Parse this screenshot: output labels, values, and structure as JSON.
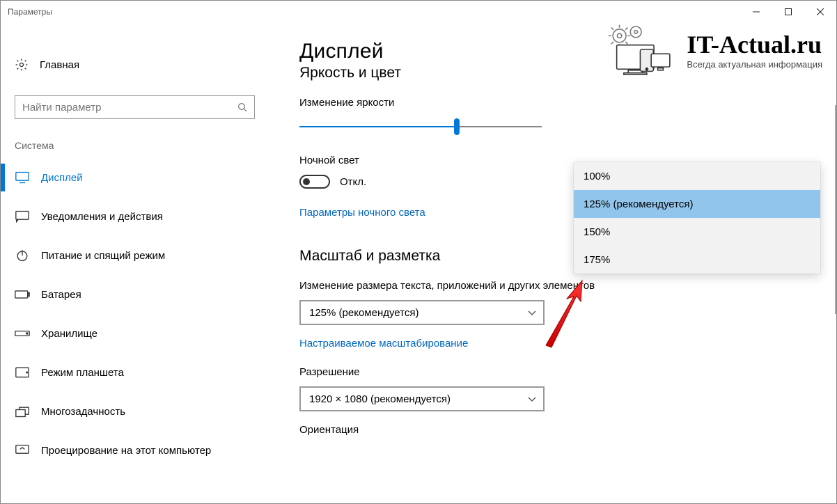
{
  "window": {
    "title": "Параметры"
  },
  "sidebar": {
    "home": "Главная",
    "search_placeholder": "Найти параметр",
    "category": "Система",
    "items": [
      {
        "label": "Дисплей",
        "icon": "monitor",
        "active": true
      },
      {
        "label": "Уведомления и действия",
        "icon": "chat"
      },
      {
        "label": "Питание и спящий режим",
        "icon": "power"
      },
      {
        "label": "Батарея",
        "icon": "battery"
      },
      {
        "label": "Хранилище",
        "icon": "storage"
      },
      {
        "label": "Режим планшета",
        "icon": "tablet"
      },
      {
        "label": "Многозадачность",
        "icon": "multitask"
      },
      {
        "label": "Проецирование на этот компьютер",
        "icon": "project"
      }
    ]
  },
  "content": {
    "page_title": "Дисплей",
    "section1": "Яркость и цвет",
    "brightness_label": "Изменение яркости",
    "brightness_percent": 65,
    "night_light_label": "Ночной свет",
    "toggle_off": "Откл.",
    "night_light_link": "Параметры ночного света",
    "section2": "Масштаб и разметка",
    "scale_label": "Изменение размера текста, приложений и других элементов",
    "scale_value": "125% (рекомендуется)",
    "custom_scaling_link": "Настраиваемое масштабирование",
    "resolution_label": "Разрешение",
    "resolution_value": "1920 × 1080 (рекомендуется)",
    "orientation_label": "Ориентация"
  },
  "dropdown": {
    "items": [
      {
        "label": "100%"
      },
      {
        "label": "125% (рекомендуется)",
        "selected": true
      },
      {
        "label": "150%"
      },
      {
        "label": "175%"
      }
    ]
  },
  "logo": {
    "main": "IT-Actual.ru",
    "sub": "Всегда актуальная информация"
  }
}
